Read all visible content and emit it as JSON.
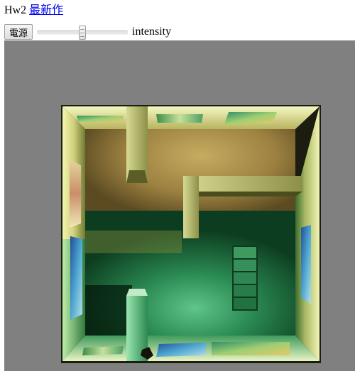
{
  "header": {
    "title": "Hw2",
    "link_label": "最新作"
  },
  "controls": {
    "power_label": "電源",
    "intensity_label": "intensity",
    "intensity_value": 0.5
  },
  "colors": {
    "canvas_bg": "#808080",
    "floor_warm": "#a98d45",
    "floor_green": "#1d6b3c",
    "wall_light": "#eef0a8",
    "link": "#0000ee"
  },
  "icons": {
    "slider_thumb": "slider-thumb-icon"
  }
}
